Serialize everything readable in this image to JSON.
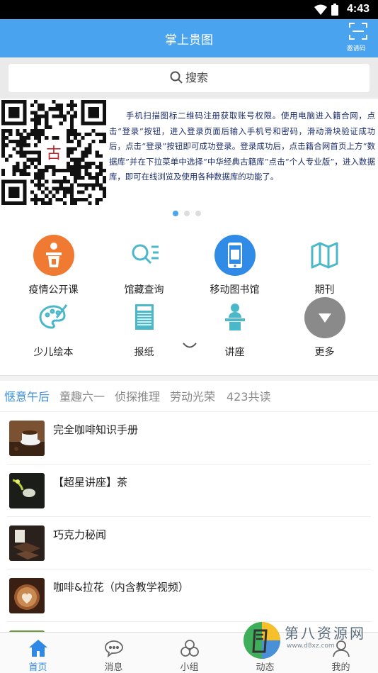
{
  "status_bar": {
    "time": "4:43"
  },
  "app_bar": {
    "title": "掌上贵图",
    "scan_label": "邀请码"
  },
  "search": {
    "placeholder": "搜索"
  },
  "banner": {
    "qr_center_char": "古",
    "text": "手机扫描图标二维码注册获取账号权限。使用电脑进入籍合网，点击“登录”按钮，进入登录页面后输入手机号和密码，滑动滑块验证成功后，点击“登录”按钮即可成功登录。登录成功后，点击籍合网首页上方“数据库”并在下拉菜单中选择“中华经典古籍库”点击“个人专业版”，进入数据库，即可在线浏览及使用各种数据库的功能了。",
    "dots": 3,
    "active_dot": 0
  },
  "features": [
    {
      "label": "疫情公开课",
      "icon": "lecture-podium-icon"
    },
    {
      "label": "馆藏查询",
      "icon": "search-list-icon"
    },
    {
      "label": "移动图书馆",
      "icon": "mobile-library-icon"
    },
    {
      "label": "期刊",
      "icon": "journal-map-icon"
    },
    {
      "label": "少儿绘本",
      "icon": "paint-palette-icon"
    },
    {
      "label": "报纸",
      "icon": "newspaper-icon"
    },
    {
      "label": "讲座",
      "icon": "speaker-icon"
    },
    {
      "label": "更多",
      "icon": "chevron-down-icon"
    }
  ],
  "tabs": [
    {
      "label": "惬意午后",
      "active": true
    },
    {
      "label": "童趣六一",
      "active": false
    },
    {
      "label": "侦探推理",
      "active": false
    },
    {
      "label": "劳动光荣",
      "active": false
    },
    {
      "label": "423共读",
      "active": false
    }
  ],
  "list": [
    {
      "title": "完全咖啡知识手册"
    },
    {
      "title": "【超星讲座】茶"
    },
    {
      "title": "巧克力秘闻"
    },
    {
      "title": "咖啡&拉花（内含教学视频）"
    },
    {
      "title": ""
    }
  ],
  "bottom_nav": [
    {
      "label": "首页",
      "icon": "home-icon",
      "active": true
    },
    {
      "label": "消息",
      "icon": "message-icon",
      "active": false
    },
    {
      "label": "小组",
      "icon": "group-icon",
      "active": false
    },
    {
      "label": "动态",
      "icon": "feed-icon",
      "active": false
    },
    {
      "label": "我的",
      "icon": "profile-icon",
      "active": false
    }
  ],
  "watermark": {
    "title": "第八资源网",
    "url": "www.d8xz.com"
  },
  "colors": {
    "primary": "#4aa3ef",
    "tab_active": "#3d8fdb",
    "orange": "#f07a32",
    "teal": "#4bb8c9"
  }
}
